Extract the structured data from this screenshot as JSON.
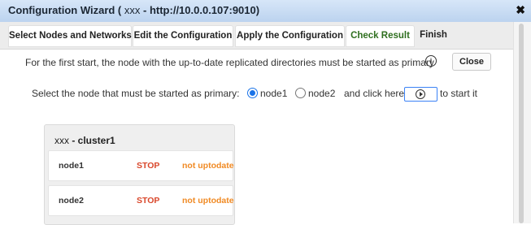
{
  "window": {
    "title_prefix": "Configuration Wizard (",
    "cluster_host": "xxx",
    "title_suffix": "- http://10.0.0.107:9010)",
    "close_glyph": "✖"
  },
  "tabs": [
    {
      "label": "Select Nodes and Networks"
    },
    {
      "label": "Edit the Configuration"
    },
    {
      "label": "Apply the Configuration"
    },
    {
      "label": "Check Result"
    },
    {
      "label": "Finish"
    }
  ],
  "info": {
    "message": "For the first start, the node with the up-to-date replicated directories must be started as primary",
    "icon": "info-icon",
    "icon_glyph": "i",
    "close_button": "Close"
  },
  "primary_select": {
    "label": "Select the node that must be started as primary:",
    "options": [
      {
        "label": "node1",
        "checked": true
      },
      {
        "label": "node2",
        "checked": false
      }
    ],
    "click_here": "and click here",
    "to_start": "to start it",
    "start_icon": "play-circle-icon"
  },
  "cluster": {
    "host": "xxx",
    "name": "- cluster1",
    "nodes": [
      {
        "name": "node1",
        "state": "STOP",
        "sync": "not uptodate"
      },
      {
        "name": "node2",
        "state": "STOP",
        "sync": "not uptodate"
      }
    ]
  },
  "colors": {
    "accent": "#1a73e8",
    "stop": "#d9472b",
    "not_uptodate": "#f08a24",
    "check_result": "#2f6f1f"
  }
}
